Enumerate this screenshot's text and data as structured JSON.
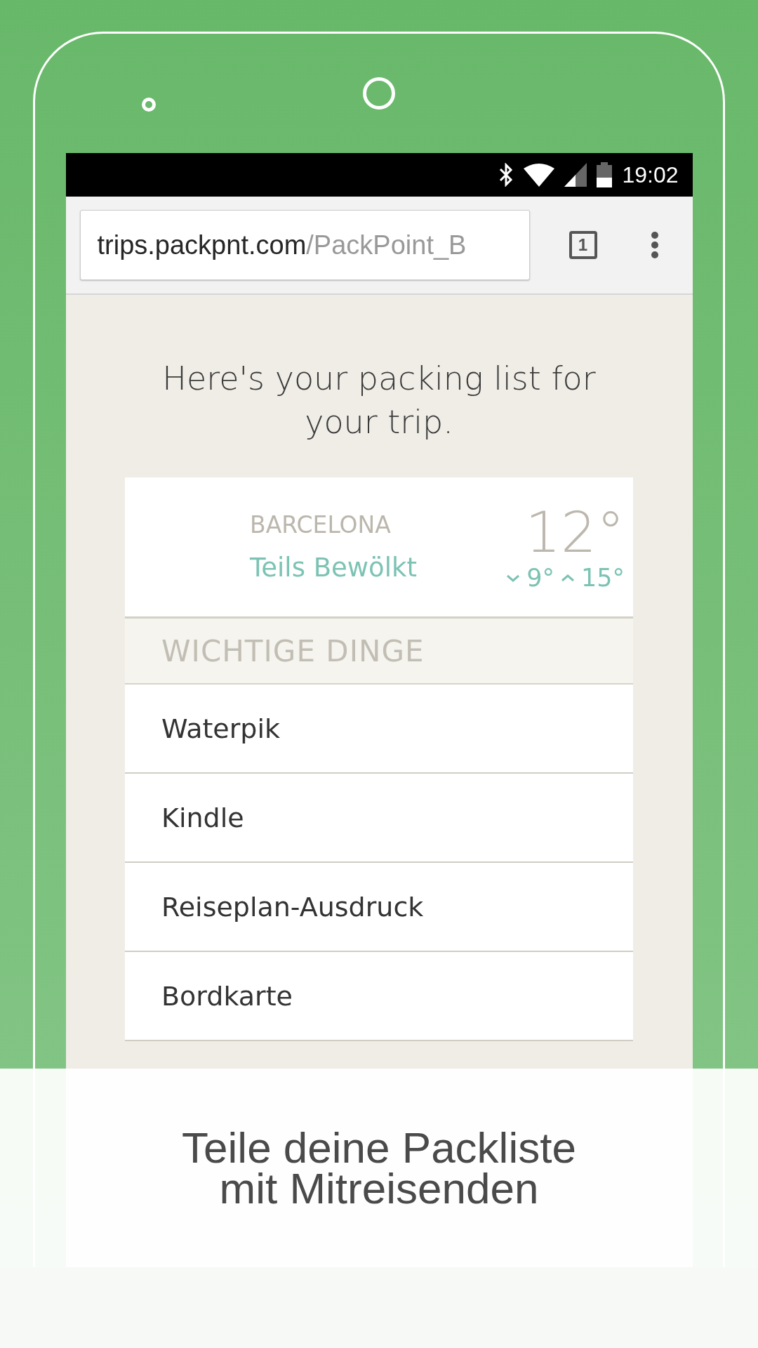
{
  "status_bar": {
    "time": "19:02"
  },
  "browser": {
    "address_host": "trips.packpnt.com",
    "address_path": "/PackPoint_B",
    "tab_count": "1"
  },
  "page": {
    "heading": "Here's your packing list for your trip.",
    "weather": {
      "city": "BARCELONA",
      "condition": "Teils Bewölkt",
      "temperature": "12°",
      "low": "9°",
      "high": "15°"
    },
    "section": "WICHTIGE DINGE",
    "items": [
      {
        "label": "Waterpik"
      },
      {
        "label": "Kindle"
      },
      {
        "label": "Reiseplan-Ausdruck"
      },
      {
        "label": "Bordkarte"
      }
    ]
  },
  "caption": "Teile deine Packliste mit Mitreisenden"
}
